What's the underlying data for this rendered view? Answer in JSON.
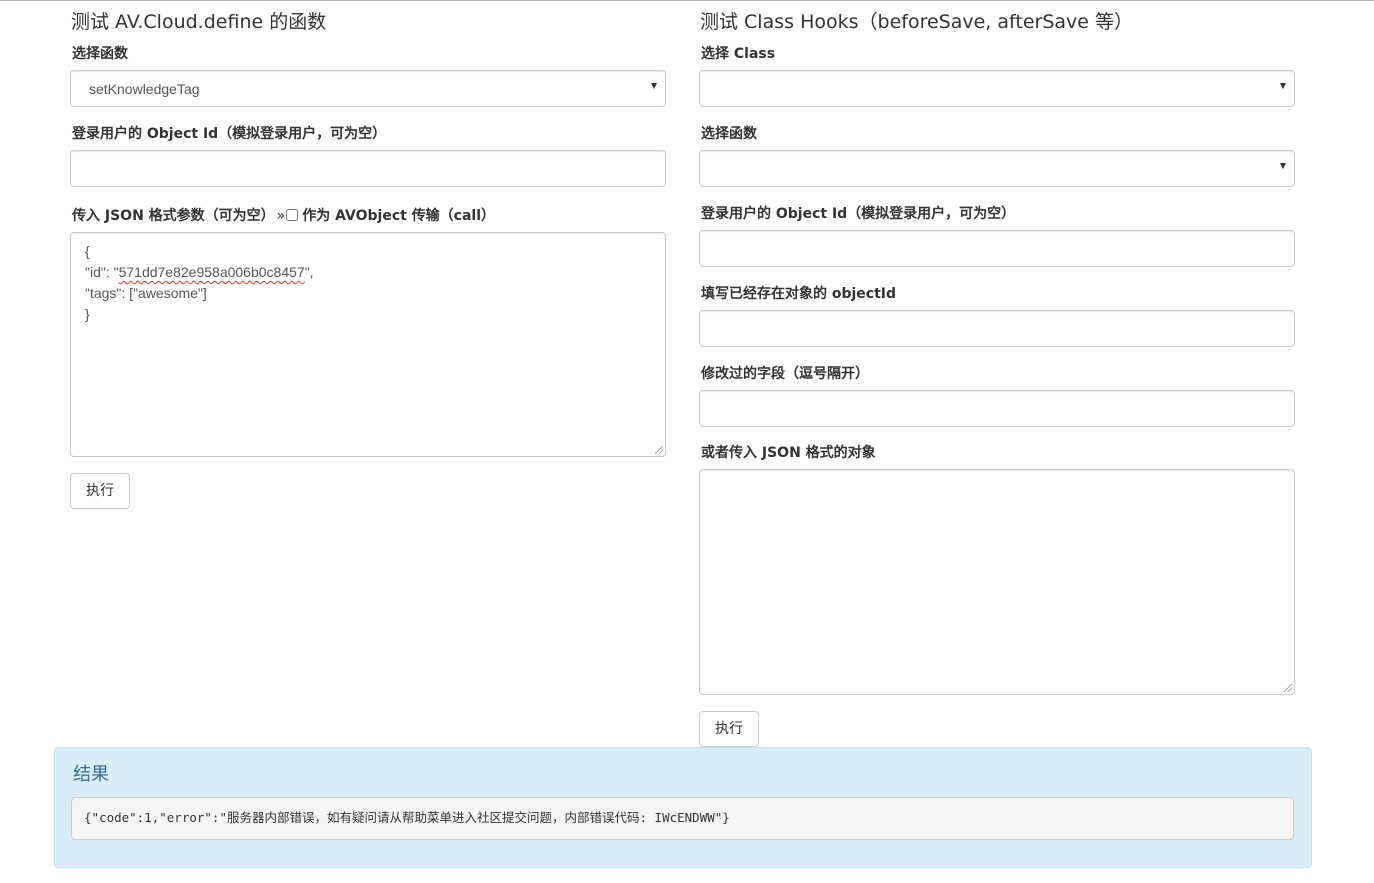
{
  "left": {
    "title": "测试 AV.Cloud.define 的函数",
    "function_label": "选择函数",
    "function_selected": "setKnowledgeTag",
    "user_label": "登录用户的 Object Id（模拟登录用户，可为空）",
    "user_value": "",
    "params_label": "传入 JSON 格式参数（可为空）",
    "params_raquo": "»",
    "as_avobject_label": "作为 AVObject 传输（call）",
    "as_avobject_checked": false,
    "params_lines": {
      "l1": "{",
      "l2_pre": "\"id\": \"",
      "l2_id": "571dd7e82e958a006b0c8457",
      "l2_post": "\",",
      "l3": "\"tags\": [\"awesome\"]",
      "l4": "}"
    },
    "run_label": "执行"
  },
  "right": {
    "title": "测试 Class Hooks（beforeSave, afterSave 等）",
    "class_label": "选择 Class",
    "class_selected": "",
    "function_label": "选择函数",
    "function_selected": "",
    "user_label": "登录用户的 Object Id（模拟登录用户，可为空）",
    "user_value": "",
    "object_id_label": "填写已经存在对象的 objectId",
    "object_id_value": "",
    "fields_label": "修改过的字段（逗号隔开）",
    "fields_value": "",
    "json_label": "或者传入 JSON 格式的对象",
    "json_value": "",
    "run_label": "执行"
  },
  "result": {
    "title": "结果",
    "output": "{\"code\":1,\"error\":\"服务器内部错误，如有疑问请从帮助菜单进入社区提交问题，内部错误代码: IWcENDWW\"}"
  },
  "colors": {
    "result_bg": "#d9edf7",
    "result_border": "#bce8f1",
    "result_title": "#31708f",
    "spellcheck": "#e0342c"
  }
}
